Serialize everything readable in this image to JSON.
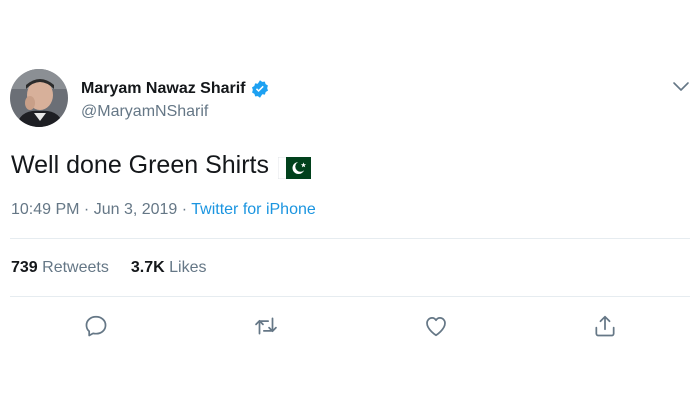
{
  "author": {
    "name": "Maryam Nawaz Sharif",
    "handle": "@MaryamNSharif",
    "verified": true
  },
  "tweet": {
    "text": "Well done Green Shirts",
    "emoji": "pakistan-flag"
  },
  "meta": {
    "time": "10:49 PM",
    "separator": " · ",
    "date": "Jun 3, 2019",
    "source": "Twitter for iPhone"
  },
  "stats": {
    "retweets_count": "739",
    "retweets_label": "Retweets",
    "likes_count": "3.7K",
    "likes_label": "Likes"
  },
  "actions": [
    "reply-icon",
    "retweet-icon",
    "like-icon",
    "share-icon"
  ],
  "colors": {
    "text": "#14171a",
    "secondary": "#657786",
    "link": "#1b95e0",
    "divider": "#e6ecf0",
    "icon": "#657786",
    "verified": "#1da1f2",
    "flag_green": "#01411c"
  }
}
